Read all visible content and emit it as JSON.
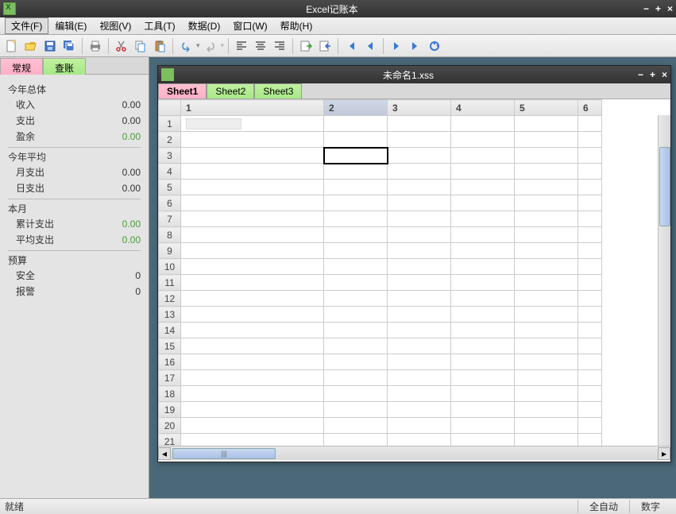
{
  "app": {
    "title": "Excel记账本"
  },
  "menu": {
    "file": "文件(F)",
    "edit": "编辑(E)",
    "view": "视图(V)",
    "tools": "工具(T)",
    "data": "数据(D)",
    "window": "窗口(W)",
    "help": "帮助(H)"
  },
  "sidebar": {
    "tabs": {
      "general": "常规",
      "audit": "查账"
    },
    "year_total": {
      "label": "今年总体",
      "income_label": "收入",
      "income": "0.00",
      "expense_label": "支出",
      "expense": "0.00",
      "surplus_label": "盈余",
      "surplus": "0.00"
    },
    "year_avg": {
      "label": "今年平均",
      "month_exp_label": "月支出",
      "month_exp": "0.00",
      "day_exp_label": "日支出",
      "day_exp": "0.00"
    },
    "this_month": {
      "label": "本月",
      "cum_exp_label": "累计支出",
      "cum_exp": "0.00",
      "avg_exp_label": "平均支出",
      "avg_exp": "0.00"
    },
    "budget": {
      "label": "预算",
      "safe_label": "安全",
      "safe": "0",
      "alarm_label": "报警",
      "alarm": "0"
    }
  },
  "doc": {
    "title": "未命名1.xss",
    "sheets": [
      "Sheet1",
      "Sheet2",
      "Sheet3"
    ],
    "columns": [
      "1",
      "2",
      "3",
      "4",
      "5",
      "6"
    ],
    "rows": 21,
    "selected": {
      "row": 3,
      "col": 2
    }
  },
  "status": {
    "ready": "就绪",
    "auto": "全自动",
    "numlock": "数字"
  }
}
